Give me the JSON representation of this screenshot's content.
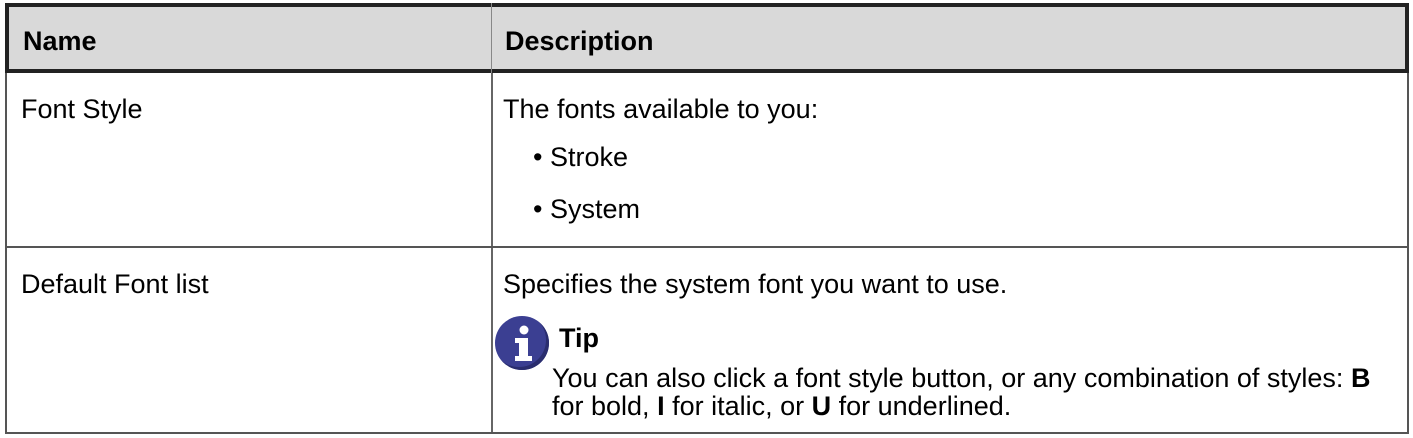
{
  "table": {
    "headers": [
      "Name",
      "Description"
    ],
    "rows": [
      {
        "name": "Font Style",
        "description": "The fonts available to you:",
        "bullets": [
          "Stroke",
          "System"
        ]
      },
      {
        "name": "Default Font list",
        "description": "Specifies the system font you want to use.",
        "tip": {
          "title": "Tip",
          "text_parts": [
            "You can also click a font style button, or any combination of styles: ",
            "B",
            " for bold, ",
            "I",
            " for italic, or ",
            "U",
            " for underlined."
          ]
        }
      }
    ]
  },
  "icons": {
    "tip_icon": "info-icon",
    "tip_icon_color": "#3b3f92"
  },
  "bullet_char": "•"
}
